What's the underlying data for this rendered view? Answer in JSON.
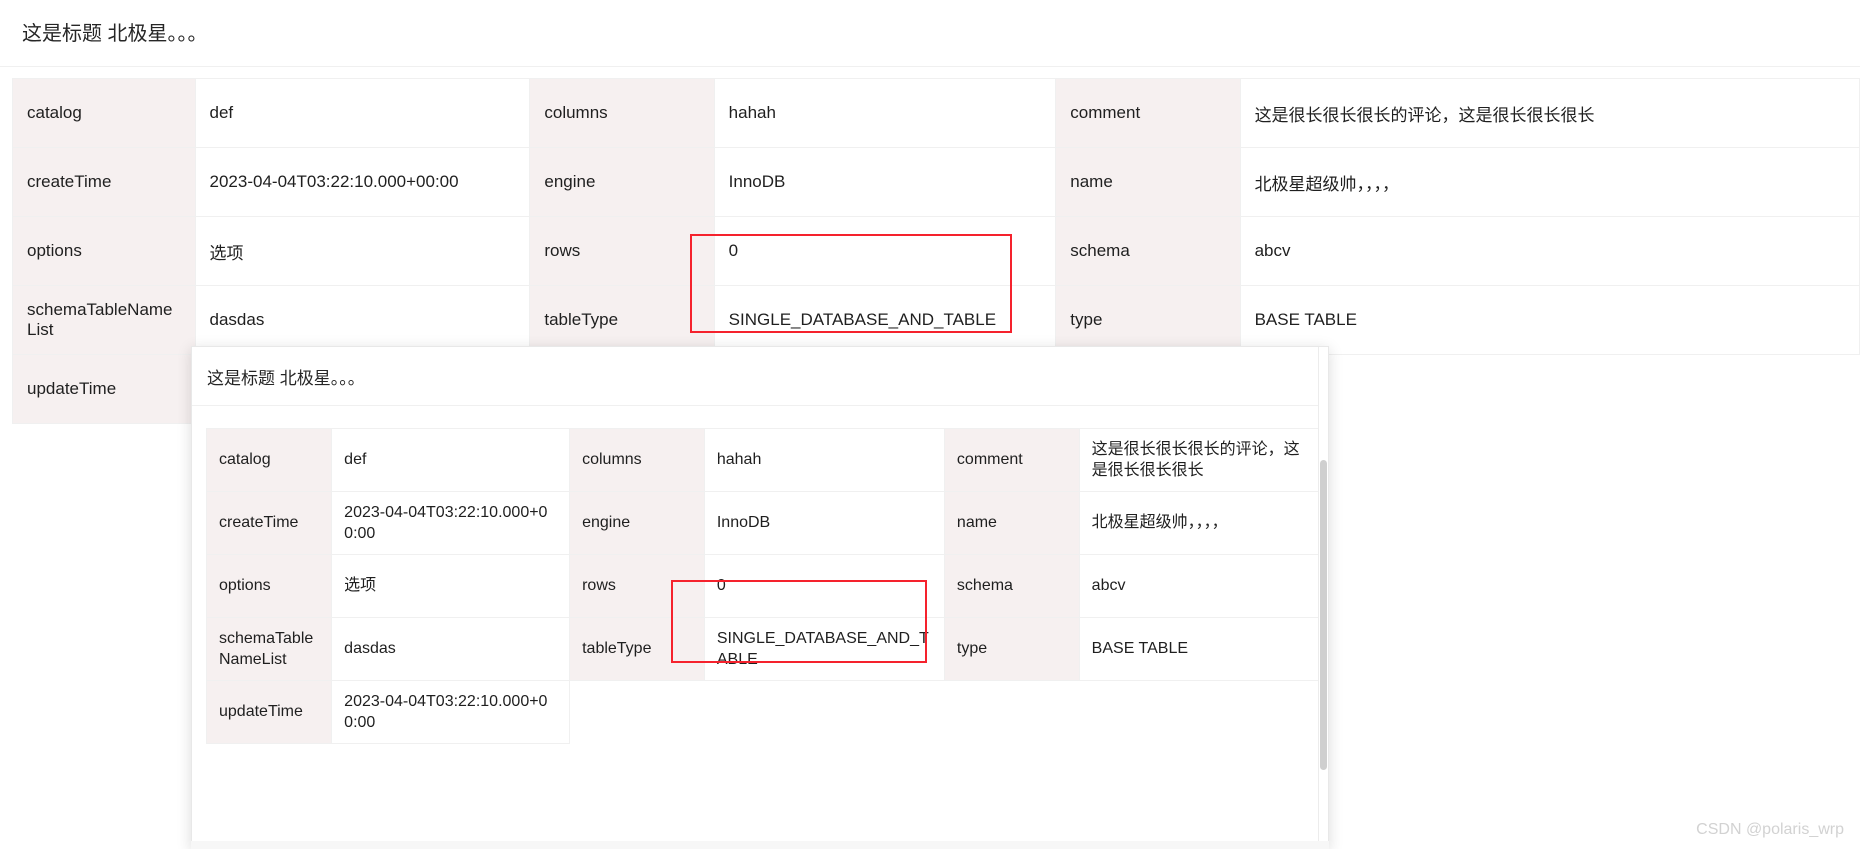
{
  "top": {
    "title": "这是标题 北极星。。。",
    "rows": [
      [
        {
          "label": "catalog",
          "value": "def"
        },
        {
          "label": "columns",
          "value": "hahah"
        },
        {
          "label": "comment",
          "value": "这是很长很长很长的评论，这是很长很长很长"
        }
      ],
      [
        {
          "label": "createTime",
          "value": "2023-04-04T03:22:10.000+00:00"
        },
        {
          "label": "engine",
          "value": "InnoDB"
        },
        {
          "label": "name",
          "value": "北极星超级帅，，，，"
        }
      ],
      [
        {
          "label": "options",
          "value": "选项"
        },
        {
          "label": "rows",
          "value": "0"
        },
        {
          "label": "schema",
          "value": "abcv"
        }
      ],
      [
        {
          "label": "schemaTableNameList",
          "value": "dasdas"
        },
        {
          "label": "tableType",
          "value": "SINGLE_DATABASE_AND_TABLE"
        },
        {
          "label": "type",
          "value": "BASE TABLE"
        }
      ],
      [
        {
          "label": "updateTime",
          "value": "2023-04-04T03:22:10.000+00:00"
        },
        {
          "label": "",
          "value": ""
        },
        {
          "label": "",
          "value": ""
        }
      ]
    ]
  },
  "panel": {
    "title": "这是标题 北极星。。。",
    "rows": [
      [
        {
          "label": "catalog",
          "value": "def"
        },
        {
          "label": "columns",
          "value": "hahah"
        },
        {
          "label": "comment",
          "value": "这是很长很长很长的评论，这是很长很长很长"
        }
      ],
      [
        {
          "label": "createTime",
          "value": "2023-04-04T03:22:10.000+00:00"
        },
        {
          "label": "engine",
          "value": "InnoDB"
        },
        {
          "label": "name",
          "value": "北极星超级帅，，，，"
        }
      ],
      [
        {
          "label": "options",
          "value": "选项"
        },
        {
          "label": "rows",
          "value": "0"
        },
        {
          "label": "schema",
          "value": "abcv"
        }
      ],
      [
        {
          "label": "schemaTableNameList",
          "value": "dasdas"
        },
        {
          "label": "tableType",
          "value": "SINGLE_DATABASE_AND_TABLE"
        },
        {
          "label": "type",
          "value": "BASE TABLE"
        }
      ],
      [
        {
          "label": "updateTime",
          "value": "2023-04-04T03:22:10.000+00:00"
        },
        {
          "label": "",
          "value": ""
        },
        {
          "label": "",
          "value": ""
        }
      ]
    ]
  },
  "annotations": {
    "highlight_color": "#f5222d",
    "top_box_target": "SINGLE_DATABASE_AND_TABLE",
    "panel_box_target": "SINGLE_DATABASE_AND_TABLE"
  },
  "theme": {
    "label_cell_bg": "#f6f0f0",
    "value_cell_bg": "#ffffff",
    "border_color": "#f0f0f0",
    "text_color": "#1f1f1f"
  },
  "watermark": {
    "text": "CSDN @polaris_wrp"
  }
}
